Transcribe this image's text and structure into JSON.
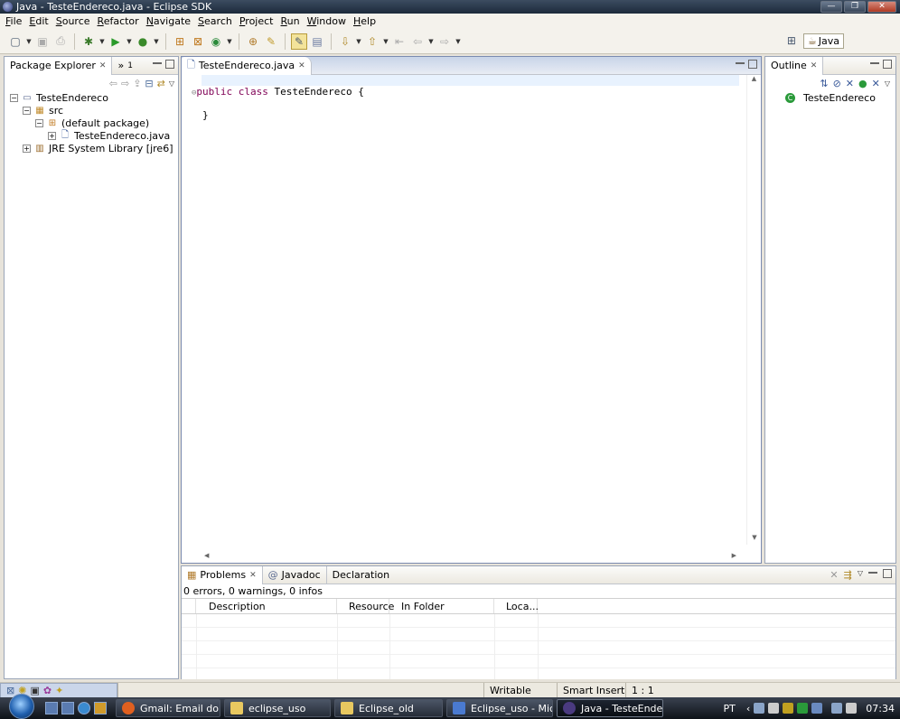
{
  "window": {
    "title": "Java - TesteEndereco.java - Eclipse SDK"
  },
  "menu": [
    {
      "m": "F",
      "rest": "ile"
    },
    {
      "m": "E",
      "rest": "dit"
    },
    {
      "m": "S",
      "rest": "ource"
    },
    {
      "m": "R",
      "rest": "efactor"
    },
    {
      "m": "N",
      "rest": "avigate"
    },
    {
      "m": "S",
      "rest": "earch"
    },
    {
      "m": "P",
      "rest": "roject"
    },
    {
      "m": "R",
      "rest": "un"
    },
    {
      "m": "W",
      "rest": "indow"
    },
    {
      "m": "H",
      "rest": "elp"
    }
  ],
  "perspective": {
    "label": "Java"
  },
  "package_explorer": {
    "tab_label": "Package Explorer",
    "hier_tab": "1",
    "tree": [
      {
        "label": "TesteEndereco",
        "indent": 0
      },
      {
        "label": "src",
        "indent": 1
      },
      {
        "label": "(default package)",
        "indent": 2
      },
      {
        "label": "TesteEndereco.java",
        "indent": 3
      },
      {
        "label": "JRE System Library [jre6]",
        "indent": 1
      }
    ]
  },
  "editor": {
    "tab_label": "TesteEndereco.java",
    "line1_kw1": "public",
    "line1_kw2": "class",
    "line1_rest": "TesteEndereco {",
    "line2": "}"
  },
  "outline": {
    "tab_label": "Outline",
    "item": "TesteEndereco"
  },
  "problems": {
    "tabs": [
      "Problems",
      "Javadoc",
      "Declaration"
    ],
    "summary": "0 errors, 0 warnings, 0 infos",
    "columns": [
      "Description",
      "Resource",
      "In Folder",
      "Loca..."
    ]
  },
  "status": {
    "writable": "Writable",
    "insert_mode": "Smart Insert",
    "position": "1 : 1"
  },
  "taskbar": {
    "tasks": [
      {
        "label": "Gmail: Email do Go...",
        "color": "#e06020"
      },
      {
        "label": "eclipse_uso",
        "color": "#e8c860"
      },
      {
        "label": "Eclipse_old",
        "color": "#e8c860"
      },
      {
        "label": "Eclipse_uso - Micros...",
        "color": "#4a7ad0"
      },
      {
        "label": "Java - TesteEnderec...",
        "color": "#4a3a80"
      }
    ],
    "lang": "PT",
    "clock": "07:34"
  }
}
